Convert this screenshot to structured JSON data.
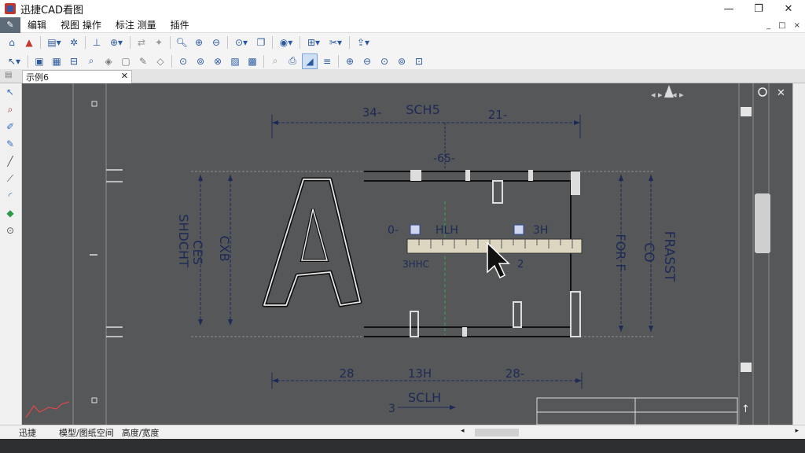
{
  "window": {
    "title": "迅捷CAD看图",
    "minimize": "—",
    "restore": "❐",
    "close": "✕"
  },
  "menu": {
    "items": [
      "编辑",
      "视图 操作",
      "标注 测量",
      "插件"
    ],
    "mdi": [
      "_",
      "□",
      "×"
    ]
  },
  "tab": {
    "label": "示例6",
    "close": "✕"
  },
  "status": {
    "items": [
      "迅捷",
      "模型/图纸空间",
      "高度/宽度"
    ]
  },
  "drawing": {
    "dim_top_left": "34-",
    "dim_top_title": "SCH5",
    "dim_top_right": "21-",
    "dim_mid_top": "-65-",
    "left_label_1": "SHDCHT",
    "left_label_2": "CES",
    "left_label_3": "CXB",
    "ruler_left_num": "0-",
    "ruler_left_label": "HLH",
    "ruler_right_label": "3H",
    "ruler_under_left": "3HHC",
    "ruler_under_right": "2",
    "right_label_1": "FOR F",
    "right_label_2": "CO",
    "right_label_3": "FRASST",
    "dim_bot_left": "28",
    "dim_bot_mid": "13H",
    "dim_bot_right": "28-",
    "dim_bot_title": "SCLH",
    "dim_bot_num": "3"
  }
}
